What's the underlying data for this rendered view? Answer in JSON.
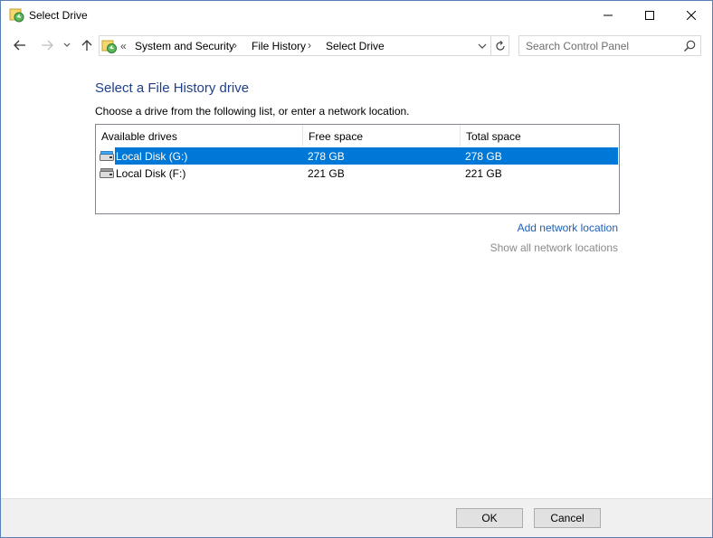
{
  "window": {
    "title": "Select Drive"
  },
  "nav": {
    "breadcrumb_overflow": "«",
    "breadcrumb": [
      "System and Security",
      "File History",
      "Select Drive"
    ],
    "separator": "›",
    "search_placeholder": "Search Control Panel"
  },
  "content": {
    "heading": "Select a File History drive",
    "instruction": "Choose a drive from the following list, or enter a network location.",
    "columns": [
      "Available drives",
      "Free space",
      "Total space"
    ],
    "drives": [
      {
        "name": "Local Disk (G:)",
        "free": "278 GB",
        "total": "278 GB",
        "selected": true
      },
      {
        "name": "Local Disk (F:)",
        "free": "221 GB",
        "total": "221 GB",
        "selected": false
      }
    ],
    "add_network_location": "Add network location",
    "show_all_network_locations": "Show all network locations"
  },
  "footer": {
    "ok_label": "OK",
    "cancel_label": "Cancel"
  },
  "colors": {
    "heading": "#1e3f8c",
    "selection": "#0078d7",
    "link": "#1e5fb5",
    "disabled_link": "#8a8a8a"
  },
  "icons": [
    "file-history-icon",
    "minimize-icon",
    "maximize-icon",
    "close-icon",
    "back-arrow-icon",
    "forward-arrow-icon",
    "chevron-down-icon",
    "up-arrow-icon",
    "refresh-icon",
    "search-icon",
    "drive-icon"
  ]
}
